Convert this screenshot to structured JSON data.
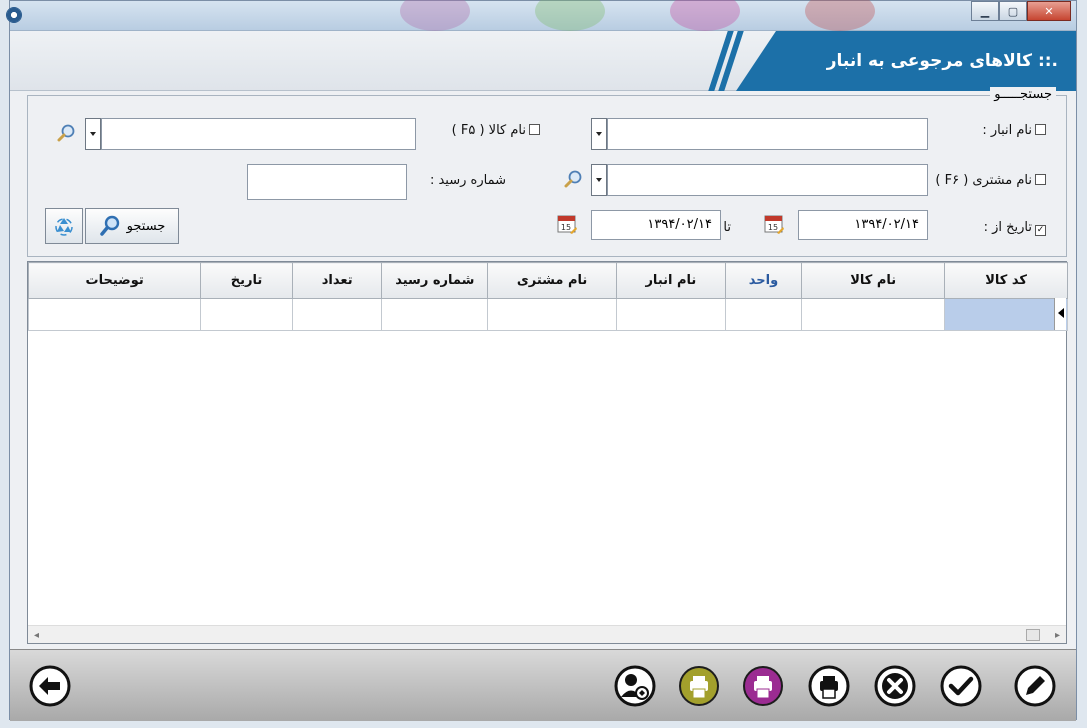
{
  "window": {
    "minimize_icon": "minimize-icon",
    "maximize_icon": "maximize-icon",
    "close_icon": "close-icon"
  },
  "header": {
    "title": ".:: کالاهای مرجوعی به انبار"
  },
  "search": {
    "legend": "جستجـــــو",
    "warehouse_label": "نام انبار :",
    "product_label": "نام کالا ( F۵ )",
    "customer_label": "نام مشتری ( F۶ )",
    "receipt_label": "شماره رسید :",
    "date_from_label": "تاریخ از :",
    "date_to_label": "تا",
    "date_from": "۱۳۹۴/۰۲/۱۴",
    "date_to": "۱۳۹۴/۰۲/۱۴",
    "date_checked": true,
    "search_button": "جستجو"
  },
  "grid": {
    "columns": [
      "کد کالا",
      "نام کالا",
      "واحد",
      "نام انبار",
      "نام مشتری",
      "شماره رسید",
      "تعداد",
      "تاریخ",
      "توضیحات"
    ]
  },
  "toolbar": {
    "icons": [
      "back-arrow-icon",
      "customer-report-icon",
      "print-icon",
      "print-icon",
      "print-icon",
      "cancel-icon",
      "confirm-icon",
      "edit-icon"
    ],
    "accent_olive": "#a3a02c",
    "accent_purple": "#9b2b92"
  }
}
